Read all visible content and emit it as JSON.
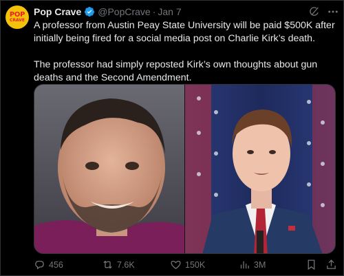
{
  "post": {
    "author_name": "Pop Crave",
    "handle": "@PopCrave",
    "separator": "·",
    "date": "Jan 7",
    "avatar_text_line1": "POP",
    "avatar_text_line2": "CRAVE",
    "paragraph1": "A professor from Austin Peay State University will be paid $500K after initially being fired for a social media post on Charlie Kirk’s death.",
    "paragraph2": "The professor had simply reposted Kirk’s own thoughts about gun deaths and the Second Amendment."
  },
  "media": {
    "left_image": "photo-professor-smiling",
    "right_image": "photo-speaker-at-podium-with-flags"
  },
  "actions": {
    "replies": "456",
    "reposts": "7.6K",
    "likes": "150K",
    "views": "3M"
  },
  "colors": {
    "background": "#000000",
    "text_primary": "#e7e9ea",
    "text_secondary": "#71767b",
    "verified_blue": "#1d9bf0",
    "avatar_yellow": "#f5c20b",
    "avatar_red": "#e8202a"
  }
}
